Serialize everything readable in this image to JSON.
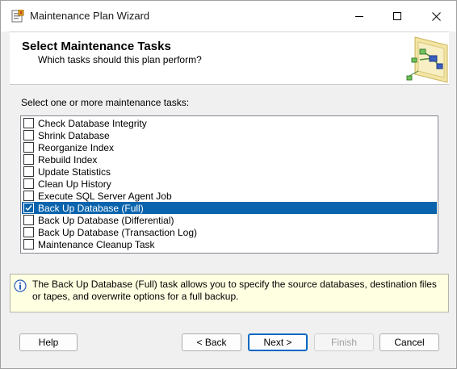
{
  "window": {
    "title": "Maintenance Plan Wizard"
  },
  "header": {
    "title": "Select Maintenance Tasks",
    "subtitle": "Which tasks should this plan perform?"
  },
  "instruction": "Select one or more maintenance tasks:",
  "tasks": [
    {
      "label": "Check Database Integrity",
      "checked": false,
      "selected": false
    },
    {
      "label": "Shrink Database",
      "checked": false,
      "selected": false
    },
    {
      "label": "Reorganize Index",
      "checked": false,
      "selected": false
    },
    {
      "label": "Rebuild Index",
      "checked": false,
      "selected": false
    },
    {
      "label": "Update Statistics",
      "checked": false,
      "selected": false
    },
    {
      "label": "Clean Up History",
      "checked": false,
      "selected": false
    },
    {
      "label": "Execute SQL Server Agent Job",
      "checked": false,
      "selected": false
    },
    {
      "label": "Back Up Database (Full)",
      "checked": true,
      "selected": true
    },
    {
      "label": "Back Up Database (Differential)",
      "checked": false,
      "selected": false
    },
    {
      "label": "Back Up Database (Transaction Log)",
      "checked": false,
      "selected": false
    },
    {
      "label": "Maintenance Cleanup Task",
      "checked": false,
      "selected": false
    }
  ],
  "description": "The Back Up Database (Full) task allows you to specify the source databases, destination files or tapes, and overwrite options for a full backup.",
  "buttons": {
    "help": "Help",
    "back": "< Back",
    "next": "Next >",
    "finish": "Finish",
    "cancel": "Cancel"
  },
  "colors": {
    "selection": "#0a64ad",
    "description_bg": "#ffffe1",
    "default_button_border": "#0067c0"
  },
  "icons": {
    "app": "wizard-app-icon",
    "header": "wizard-flowchart-graphic",
    "description": "info-icon"
  }
}
